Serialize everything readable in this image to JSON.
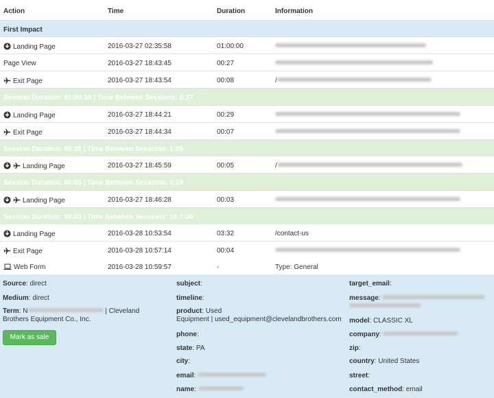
{
  "header": {
    "action": "Action",
    "time": "Time",
    "duration": "Duration",
    "information": "Information"
  },
  "first_impact": "First Impact",
  "rows": [
    {
      "icons": [
        "download-circle"
      ],
      "action": "Landing Page",
      "time": "2016-03-27 02:35:58",
      "duration": "01:00:00",
      "info": "",
      "info_blurred": true
    },
    {
      "icons": [],
      "action": "Page View",
      "time": "2016-03-27 18:43:45",
      "duration": "00:27",
      "info": "",
      "info_blurred": true
    },
    {
      "icons": [
        "plane"
      ],
      "action": "Exit Page",
      "time": "2016-03-27 18:43:54",
      "duration": "00:08",
      "info": "/",
      "info_blurred": true
    },
    {
      "icons": [
        "download-circle"
      ],
      "action": "Landing Page",
      "time": "2016-03-27 18:44:21",
      "duration": "00:29",
      "info": "",
      "info_blurred": true
    },
    {
      "icons": [
        "plane"
      ],
      "action": "Exit Page",
      "time": "2016-03-27 18:44:34",
      "duration": "00:07",
      "info": "",
      "info_blurred": true
    },
    {
      "icons": [
        "download-circle",
        "plane"
      ],
      "action": "Landing Page",
      "time": "2016-03-27 18:45:59",
      "duration": "00:05",
      "info": "/",
      "info_blurred": true
    },
    {
      "icons": [
        "download-circle",
        "plane"
      ],
      "action": "Landing Page",
      "time": "2016-03-27 18:46:28",
      "duration": "00:03",
      "info": "",
      "info_blurred": true
    },
    {
      "icons": [
        "download-circle"
      ],
      "action": "Landing Page",
      "time": "2016-03-28 10:53:54",
      "duration": "03:32",
      "info": "/contact-us",
      "info_blurred": false
    },
    {
      "icons": [
        "plane"
      ],
      "action": "Exit Page",
      "time": "2016-03-28 10:57:14",
      "duration": "00:04",
      "info": "",
      "info_blurred": true
    },
    {
      "icons": [
        "laptop"
      ],
      "action": "Web Form",
      "time": "2016-03-28 10:59:57",
      "duration": "-",
      "info": "Type: General",
      "info_blurred": false
    }
  ],
  "sessions": [
    "Session Duration: 01:00:35 | Time Between Sessions: 0:27",
    "Session Duration: 00:38 | Time Between Sessions: 1:25",
    "Session Duration: 00:05 | Time Between Sessions: 0:29",
    "Session Duration: 00:03 | Time Between Sessions: 16:7:26"
  ],
  "details": {
    "source_label": "Source",
    "source_value": "direct",
    "medium_label": "Medium",
    "medium_value": "direct",
    "term_label": "Term",
    "term_value_1": "N",
    "term_value_2": "| Cleveland",
    "term_value_3": "Brothers Equipment Co., Inc.",
    "mark_sale": "Mark as sale",
    "subject_label": "subject",
    "timeline_label": "timeline",
    "product_label": "product",
    "product_value_1": "Used",
    "product_value_2": "Equipment | used_equipment@clevelandbrothers.com",
    "phone_label": "phone",
    "state_label": "state",
    "state_value": "PA",
    "city_label": "city",
    "email_label": "email",
    "name_label": "name",
    "target_email_label": "target_email",
    "message_label": "message",
    "model_label": "model",
    "model_value": "CLASSIC XL",
    "company_label": "company",
    "zip_label": "zip",
    "country_label": "country",
    "country_value": "United States",
    "street_label": "street",
    "contact_method_label": "contact_method",
    "contact_method_value": "email"
  },
  "colors": {
    "first_impact_bg": "#d9eaf7",
    "session_bg": "#dff0d8",
    "sale_button": "#5cb85c"
  }
}
